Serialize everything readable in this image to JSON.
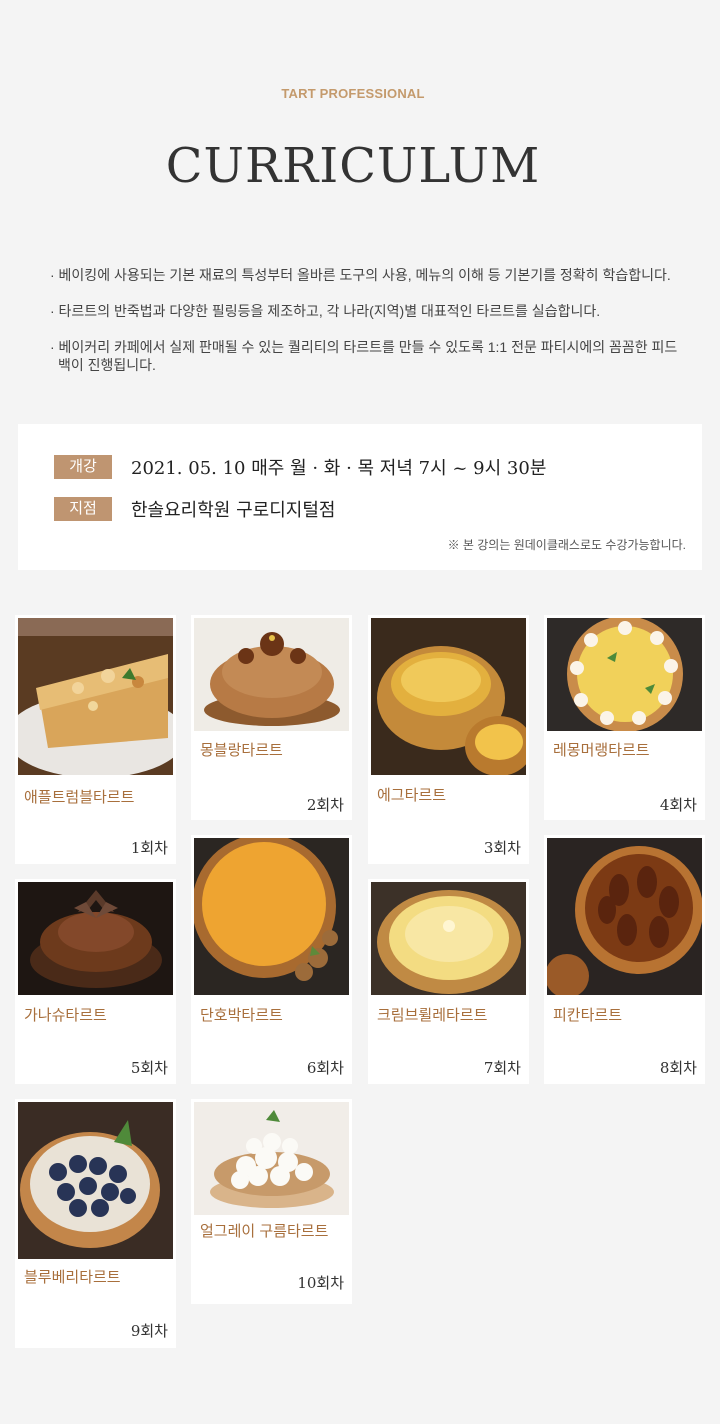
{
  "header": {
    "eyebrow": "TART PROFESSIONAL",
    "title": "CURRICULUM"
  },
  "intro": [
    "· 베이킹에 사용되는 기본 재료의 특성부터 올바른 도구의 사용, 메뉴의 이해 등 기본기를 정확히 학습합니다.",
    "· 타르트의 반죽법과 다양한 필링등을 제조하고, 각 나라(지역)별 대표적인 타르트를 실습합니다.",
    "· 베이커리 카페에서 실제 판매될 수 있는 퀄리티의 타르트를 만들 수 있도록 1:1 전문 파티시에의 꼼꼼한 피드백이 진행됩니다."
  ],
  "info": {
    "open_label": "개강",
    "open_value": "2021. 05. 10  매주 월 · 화 · 목 저녁 7시 ~ 9시 30분",
    "branch_label": "지점",
    "branch_value": "한솔요리학원 구로디지털점",
    "note": "※ 본 강의는 원데이클래스로도 수강가능합니다."
  },
  "colors": {
    "accent": "#bf9571",
    "name_text": "#a86f3c",
    "eyebrow": "#c49a6c",
    "background": "#f4f4f4"
  },
  "lessons": [
    {
      "name": "애플트럼블타르트",
      "session": "1회차",
      "photo": "apple-crumble-tart-photo"
    },
    {
      "name": "몽블랑타르트",
      "session": "2회차",
      "photo": "mont-blanc-tart-photo"
    },
    {
      "name": "에그타르트",
      "session": "3회차",
      "photo": "egg-tart-photo"
    },
    {
      "name": "레몽머랭타르트",
      "session": "4회차",
      "photo": "lemon-meringue-tart-photo"
    },
    {
      "name": "가나슈타르트",
      "session": "5회차",
      "photo": "ganache-tart-photo"
    },
    {
      "name": "단호박타르트",
      "session": "6회차",
      "photo": "pumpkin-tart-photo"
    },
    {
      "name": "크림브륄레타르트",
      "session": "7회차",
      "photo": "creme-brulee-tart-photo"
    },
    {
      "name": "피칸타르트",
      "session": "8회차",
      "photo": "pecan-tart-photo"
    },
    {
      "name": "블루베리타르트",
      "session": "9회차",
      "photo": "blueberry-tart-photo"
    },
    {
      "name": "얼그레이 구름타르트",
      "session": "10회차",
      "photo": "earl-grey-cloud-tart-photo"
    }
  ]
}
